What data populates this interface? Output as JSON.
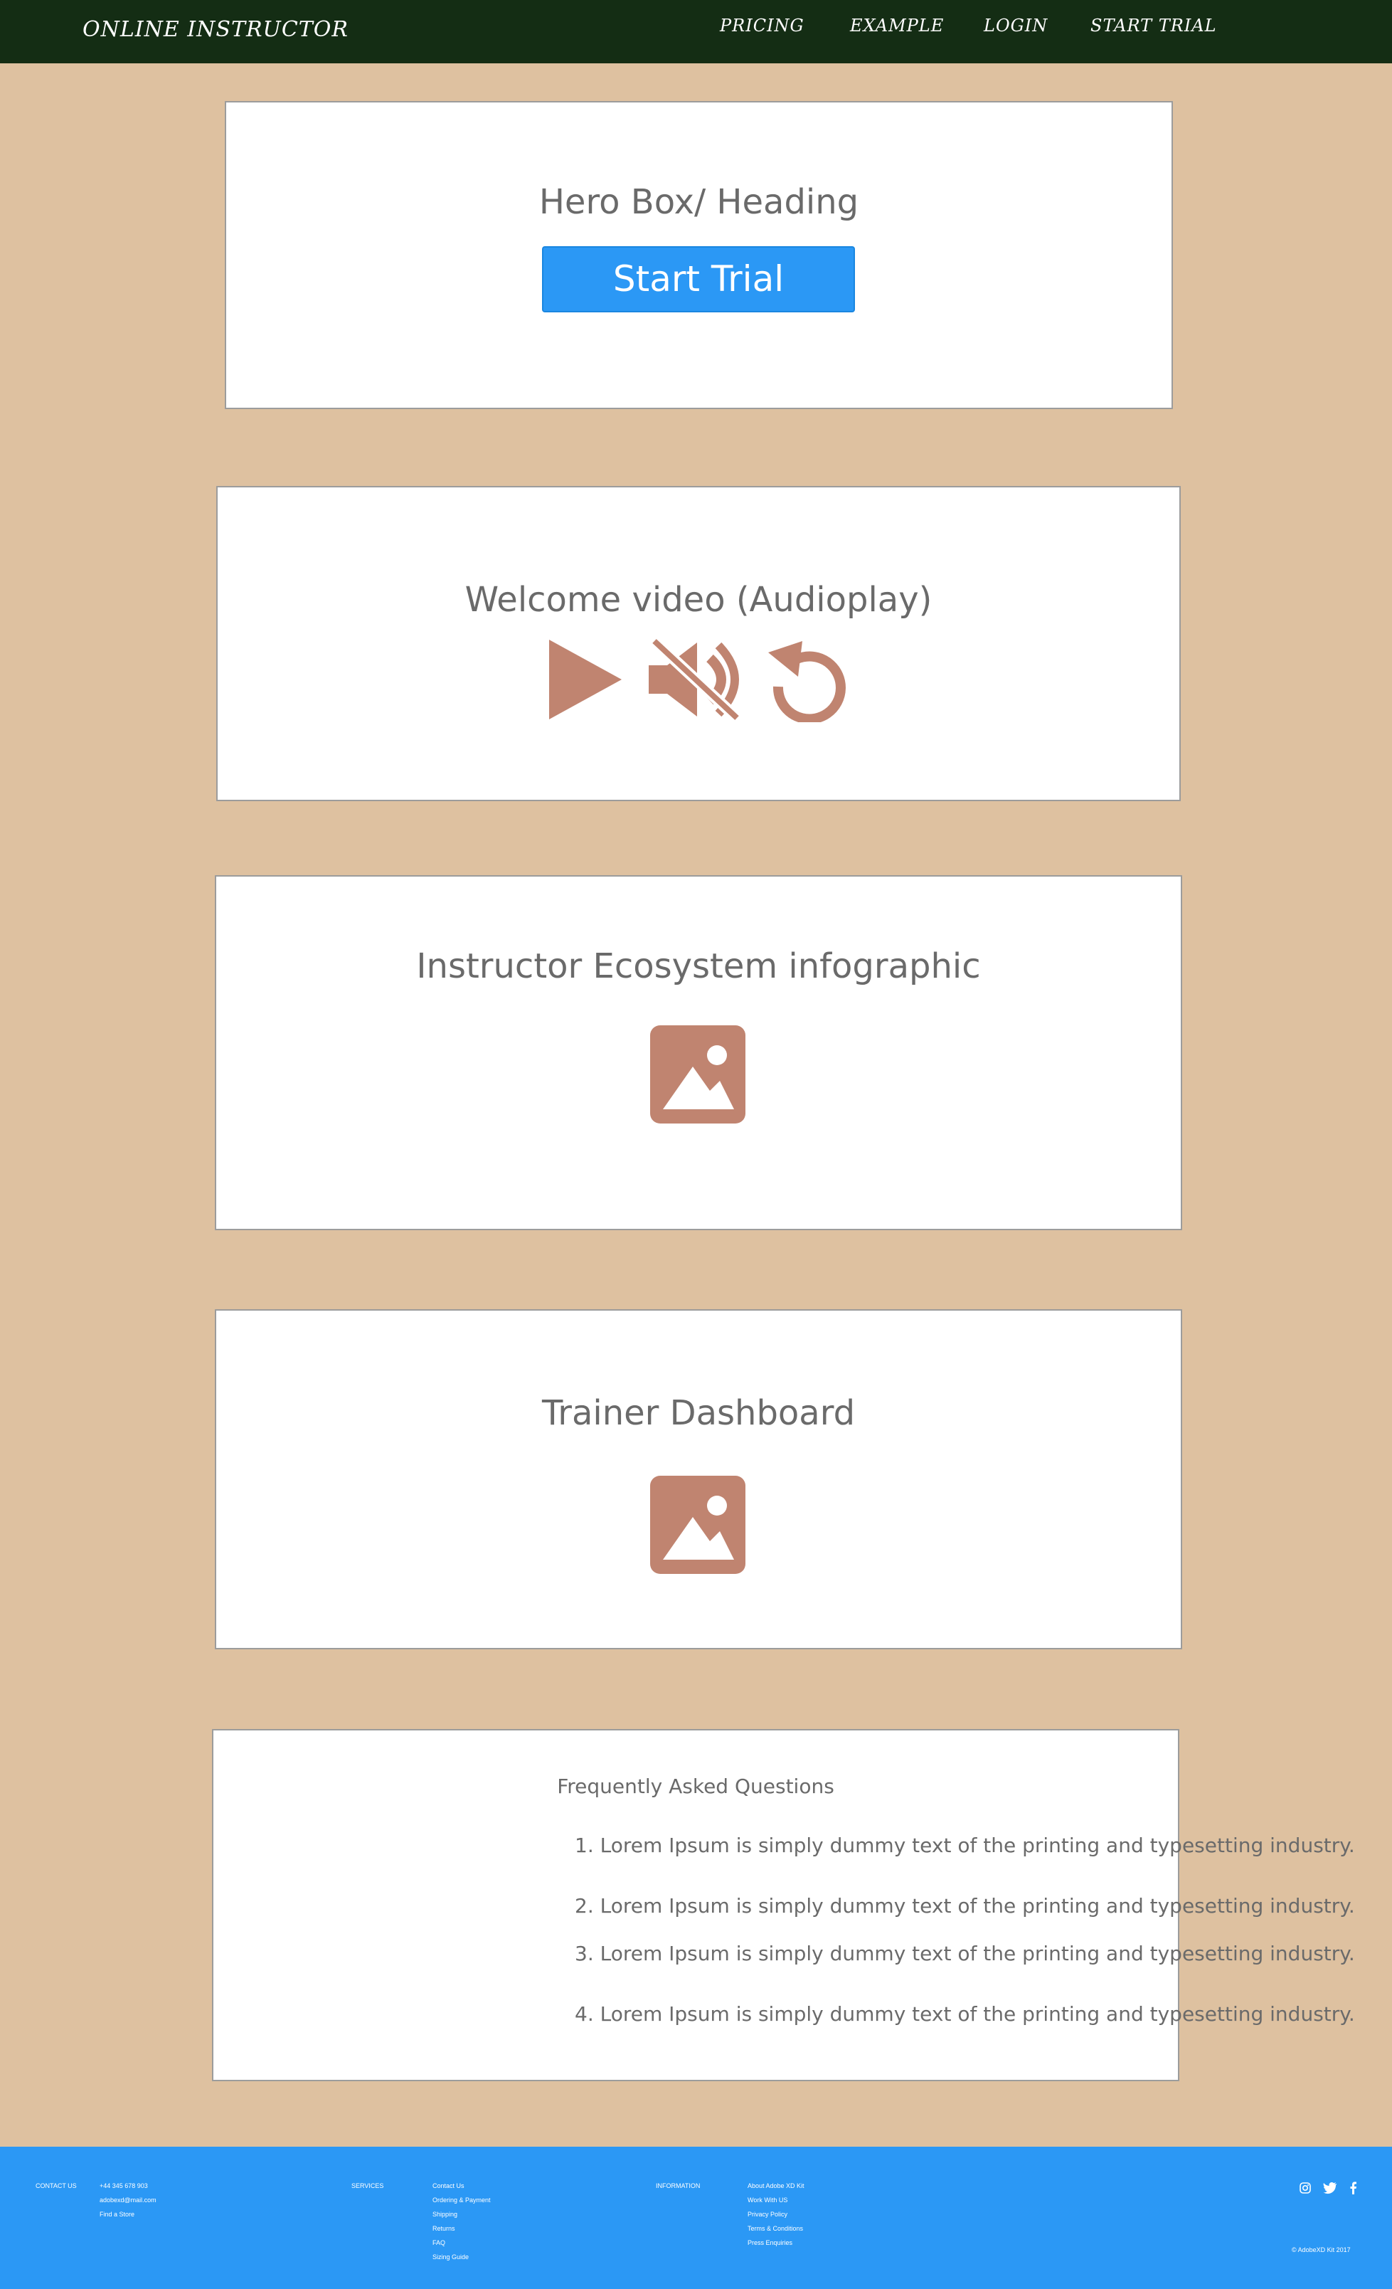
{
  "nav": {
    "brand": "ONLINE INSTRUCTOR",
    "links": [
      "PRICING",
      "EXAMPLE",
      "LOGIN",
      "START TRIAL"
    ]
  },
  "hero": {
    "heading": "Hero Box/ Heading",
    "button_label": "Start Trial"
  },
  "video": {
    "title": "Welcome video (Audioplay)",
    "controls": [
      "play-icon",
      "mute-icon",
      "replay-icon"
    ]
  },
  "infographic": {
    "title": "Instructor Ecosystem infographic",
    "icon": "image-icon"
  },
  "dashboard": {
    "title": "Trainer Dashboard",
    "icon": "image-icon"
  },
  "faq": {
    "title": "Frequently Asked Questions",
    "items": [
      "1. Lorem Ipsum is simply dummy text of the printing and typesetting industry.",
      "2. Lorem Ipsum is simply dummy text of the printing and typesetting industry.",
      "3. Lorem Ipsum is simply dummy text of the printing and typesetting industry.",
      "4. Lorem Ipsum is simply dummy text of the printing and typesetting industry."
    ]
  },
  "footer": {
    "contact_heading": "CONTACT US",
    "contact_lines": [
      "+44 345 678 903",
      "adobexd@mail.com",
      "Find a Store"
    ],
    "services_heading": "SERVICES",
    "services_links": [
      "Contact Us",
      "Ordering & Payment",
      "Shipping",
      "Returns",
      "FAQ",
      "Sizing Guide"
    ],
    "info_heading": "INFORMATION",
    "info_links": [
      "About Adobe XD Kit",
      "Work With US",
      "Privacy Policy",
      "Terms & Conditions",
      "Press Enquiries"
    ],
    "social_icons": [
      "instagram-icon",
      "twitter-icon",
      "facebook-icon"
    ],
    "copyright": "© AdobeXD Kit 2017"
  },
  "colors": {
    "nav_bg": "#142d14",
    "page_bg": "#dec1a0",
    "accent_blue": "#2b98f5",
    "icon_color": "#c08470"
  }
}
